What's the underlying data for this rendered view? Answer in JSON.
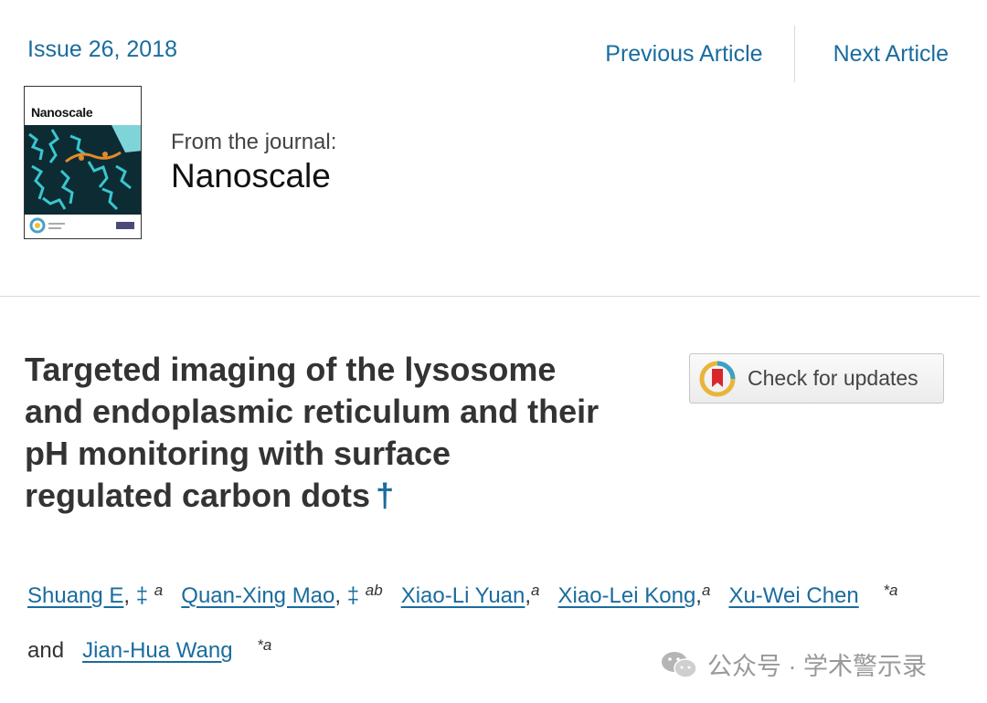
{
  "header": {
    "issue": "Issue 26, 2018",
    "prev": "Previous Article",
    "next": "Next Article"
  },
  "journal": {
    "cover_title": "Nanoscale",
    "from_label": "From the journal:",
    "name": "Nanoscale"
  },
  "article": {
    "title_lines": [
      "Targeted imaging of the lysosome",
      "and endoplasmic reticulum and their",
      "pH monitoring with surface",
      "regulated carbon dots"
    ],
    "title_dagger": "†",
    "check_updates": "Check for updates"
  },
  "authors": [
    {
      "name": "Shuang E",
      "marker": "‡",
      "aff": "a"
    },
    {
      "name": "Quan-Xing Mao",
      "marker": "‡",
      "aff": "ab"
    },
    {
      "name": "Xiao-Li Yuan",
      "marker": "",
      "aff": "a"
    },
    {
      "name": "Xiao-Lei Kong",
      "marker": "",
      "aff": "a"
    },
    {
      "name": "Xu-Wei Chen",
      "marker": "*",
      "aff": "a"
    },
    {
      "name": "Jian-Hua Wang",
      "marker": "*",
      "aff": "a"
    }
  ],
  "authors_and": "and",
  "watermark": "公众号 · 学术警示录",
  "colors": {
    "link": "#1a6c9e",
    "title": "#333333"
  },
  "icons": [
    "check-updates-icon",
    "wechat-icon"
  ]
}
